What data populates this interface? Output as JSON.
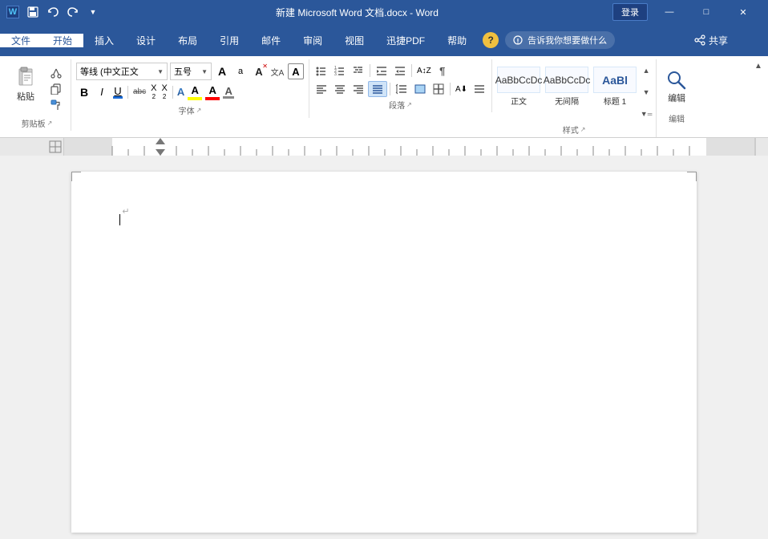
{
  "titlebar": {
    "title": "新建 Microsoft Word 文档.docx - Word",
    "login": "登录",
    "save_icon": "💾",
    "undo_icon": "↩",
    "redo_icon": "↪",
    "minimize": "—",
    "restore": "□",
    "close": "✕"
  },
  "menu": {
    "items": [
      "文件",
      "开始",
      "插入",
      "设计",
      "布局",
      "引用",
      "邮件",
      "审阅",
      "视图",
      "迅捷PDF",
      "帮助"
    ],
    "active_index": 1
  },
  "ribbon": {
    "clipboard": {
      "label": "剪贴板",
      "paste": "粘贴",
      "cut": "✂",
      "copy": "⎘",
      "format_paint": "🖌"
    },
    "font": {
      "label": "字体",
      "font_name": "等线 (中文正文",
      "font_size": "五号",
      "grow": "A",
      "shrink": "a",
      "clear": "A",
      "bold": "B",
      "italic": "I",
      "underline": "U",
      "strikethrough": "abc",
      "subscript": "X₂",
      "superscript": "X²",
      "text_effect": "A",
      "highlight": "A",
      "font_color": "A"
    },
    "paragraph": {
      "label": "段落"
    },
    "style": {
      "label": "样式",
      "items": [
        {
          "label": "正文",
          "preview": "AaBbCcDc"
        },
        {
          "label": "无间隔",
          "preview": "AaBbCcDc"
        },
        {
          "label": "标题 1",
          "preview": "AaBl"
        }
      ]
    },
    "editing": {
      "label": "编辑",
      "icon": "🔍"
    }
  },
  "ruler": {
    "visible": true
  },
  "document": {
    "content": "",
    "enter_mark": "↵"
  },
  "help": {
    "tell_me": "告诉我你想要做什么",
    "icon": "?",
    "share": "共享"
  }
}
